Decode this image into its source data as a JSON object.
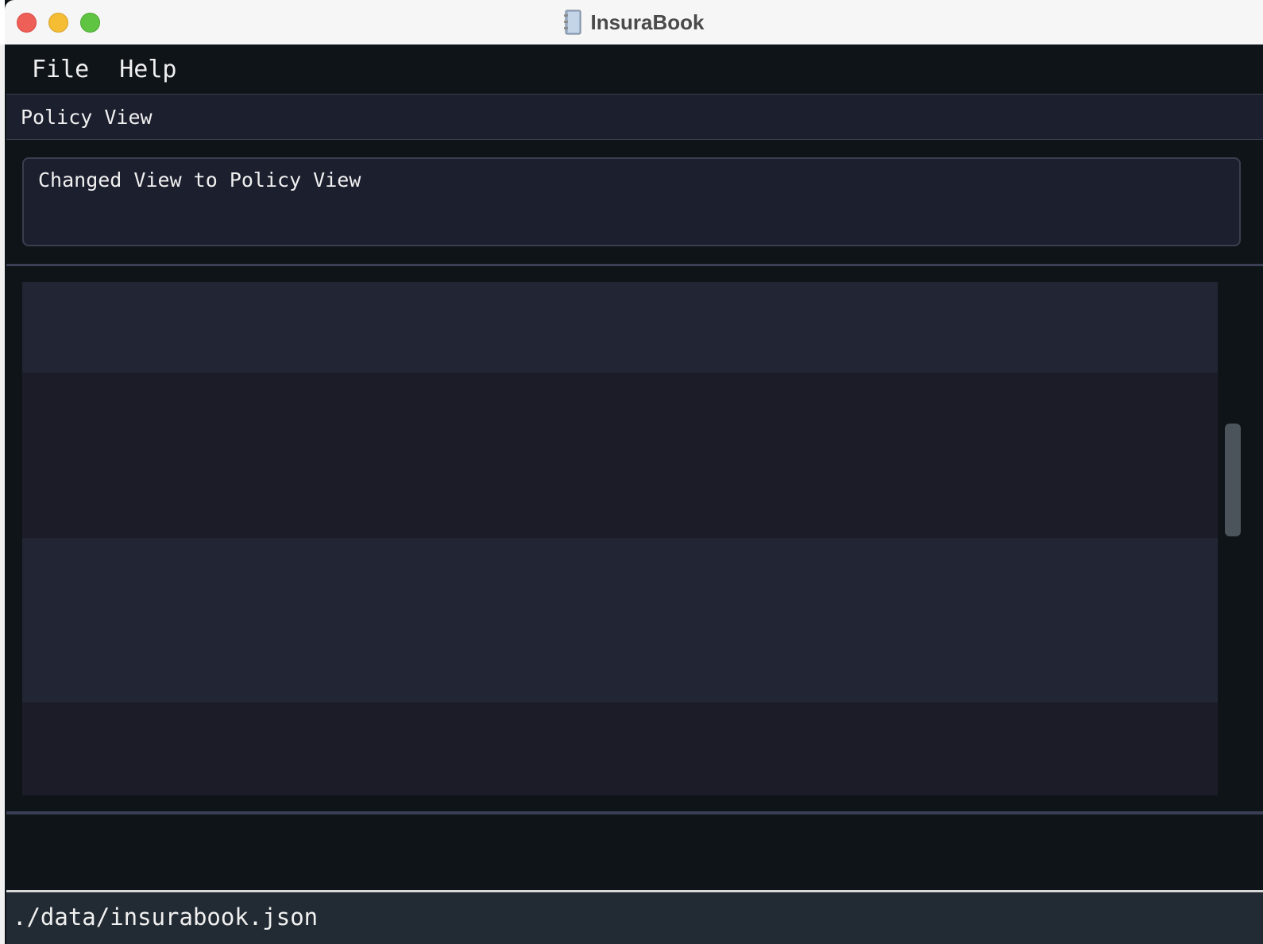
{
  "window": {
    "title": "InsuraBook",
    "app_icon": "notebook-icon"
  },
  "menu": {
    "items": [
      "File",
      "Help"
    ]
  },
  "view": {
    "label": "Policy View"
  },
  "result": {
    "message": "Changed View to Policy View"
  },
  "command": {
    "value": "",
    "placeholder": ""
  },
  "status": {
    "file_path": "./data/insurabook.json"
  },
  "colors": {
    "background": "#0f1419",
    "panel": "#1c1f2e",
    "row_light": "#222534",
    "row_dark": "#1c1c28",
    "status_bar": "#222a33",
    "text": "#f0f0f0"
  }
}
